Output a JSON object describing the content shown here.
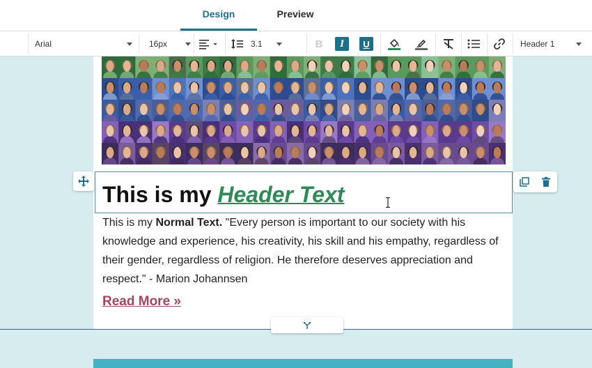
{
  "tabs": [
    {
      "label": "Design",
      "active": true
    },
    {
      "label": "Preview",
      "active": false
    }
  ],
  "toolbar": {
    "font_family": "Arial",
    "font_size": "16px",
    "line_height": "3.1",
    "block_style": "Header 1",
    "icons": [
      "align-left-icon",
      "line-height-icon",
      "bold-icon",
      "italic-icon",
      "underline-icon",
      "fill-color-icon",
      "text-color-icon",
      "clear-format-icon",
      "bullet-list-icon",
      "link-icon"
    ],
    "colors": {
      "accent": "#1f6f8b",
      "italic_btn": "#1f6f8b",
      "underline_btn": "#1f6f8b",
      "fill_bar": "#2e8b57"
    }
  },
  "content": {
    "header_plain": "This is my ",
    "header_link": "Header Text ",
    "body_prefix": "This is my ",
    "body_bold": "Normal Text.",
    "body_rest": " \"Every person is important to our society with his knowledge and experience, his creativity, his skill and his empathy, regardless of their gender, regardless of religion. He therefore deserves appreciation and respect.\"  - Marion Johannsen",
    "read_more": "Read More »"
  },
  "colors": {
    "background": "#d6ecef",
    "header_link": "#2e8b57",
    "read_more": "#a0485f",
    "section_accent": "#43b3c3"
  }
}
